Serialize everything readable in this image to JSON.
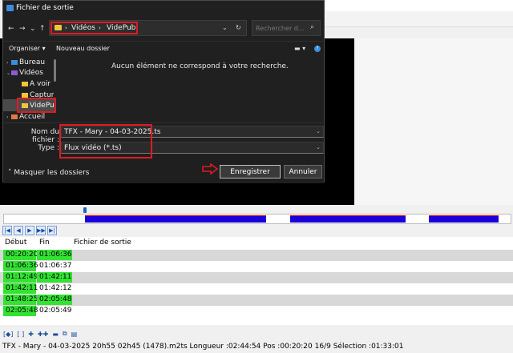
{
  "dialog": {
    "title": "Fichier de sortie",
    "address": {
      "path": [
        "Vidéos",
        "VidePub"
      ]
    },
    "search": {
      "placeholder": "Rechercher d..."
    },
    "commands": {
      "organize": "Organiser",
      "new_folder": "Nouveau dossier"
    },
    "tree": [
      {
        "label": "Bureau",
        "icon": "desktop-icon"
      },
      {
        "label": "Vidéos",
        "icon": "videos-icon"
      },
      {
        "label": "A voir",
        "icon": "folder-icon"
      },
      {
        "label": "Captur",
        "icon": "folder-icon"
      },
      {
        "label": "VidePu",
        "icon": "folder-icon",
        "selected": true
      },
      {
        "label": "Accueil",
        "icon": "home-icon"
      }
    ],
    "empty_message": "Aucun élément ne correspond à votre recherche.",
    "filename": {
      "label": "Nom du fichier :",
      "value": "TFX - Mary - 04-03-2025.ts"
    },
    "type": {
      "label": "Type :",
      "value": "Flux vidéo (*.ts)"
    },
    "hide_folders": "Masquer les dossiers",
    "save_label": "Enregistrer",
    "cancel_label": "Annuler",
    "highlight_color": "#e01a22"
  },
  "cut_list": {
    "headers": {
      "start": "Début",
      "end": "Fin",
      "output": "Fichier de sortie"
    },
    "rows": [
      {
        "start": "00:20:20",
        "end": "01:06:36",
        "start_green": true,
        "end_green": true
      },
      {
        "start": "01:06:36",
        "end": "01:06:37",
        "start_green": true,
        "end_green": false
      },
      {
        "start": "01:12:49",
        "end": "01:42:11",
        "start_green": true,
        "end_green": true
      },
      {
        "start": "01:42:11",
        "end": "01:42:12",
        "start_green": true,
        "end_green": false
      },
      {
        "start": "01:48:25",
        "end": "02:05:48",
        "start_green": true,
        "end_green": true
      },
      {
        "start": "02:05:48",
        "end": "02:05:49",
        "start_green": true,
        "end_green": false
      }
    ],
    "green_color": "#33e233"
  },
  "timeline": {
    "segment_color": "#1a00d9"
  },
  "status_bar": {
    "text": "TFX - Mary - 04-03-2025 20h55 02h45 (1478).m2ts Longueur :02:44:54 Pos :00:20:20 16/9   Sélection :01:33:01"
  }
}
